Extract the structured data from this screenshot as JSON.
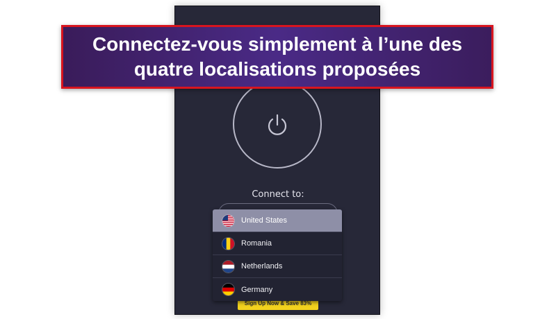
{
  "banner": {
    "line1": "Connectez-vous simplement à l’une des",
    "line2": "quatre localisations proposées"
  },
  "app": {
    "power_icon": "power-icon",
    "connect_label": "Connect to:",
    "promo_label": "Sign Up Now & Save 83%"
  },
  "locations": [
    {
      "label": "United States",
      "flag": "us-flag-icon",
      "selected": true
    },
    {
      "label": "Romania",
      "flag": "romania-flag-icon",
      "selected": false
    },
    {
      "label": "Netherlands",
      "flag": "netherlands-flag-icon",
      "selected": false
    },
    {
      "label": "Germany",
      "flag": "germany-flag-icon",
      "selected": false
    }
  ],
  "colors": {
    "banner_border": "#d8151f",
    "banner_bg": "#4a2a86",
    "app_bg": "#272838",
    "selected_row": "#8e8fa7",
    "promo": "#f2d21e"
  }
}
